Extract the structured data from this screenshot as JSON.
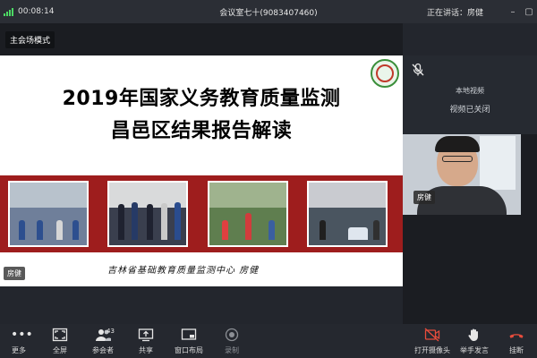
{
  "status": {
    "timer": "00:08:14",
    "meeting_title": "会议室七十(9083407460)",
    "speaker": "正在讲话：房健"
  },
  "mode": {
    "label": "主会场模式"
  },
  "slide": {
    "title_line1": "2019年国家义务教育质量监测",
    "title_line2": "昌邑区结果报告解读",
    "footer": "吉林省基础教育质量监测中心    房健",
    "presenter_tag": "房健"
  },
  "side_panel": {
    "local_video_line1": "本地视频",
    "local_video_line2": "视频已关闭",
    "camera_name": "房健"
  },
  "toolbar": {
    "more": "更多",
    "fullscreen": "全屏",
    "participants": "参会者",
    "participants_count": "43",
    "share": "共享",
    "layout": "窗口布局",
    "record": "录制",
    "camera": "打开摄像头",
    "raise_hand": "举手发言",
    "hangup": "挂断"
  },
  "colors": {
    "banner_red": "#9e1d1d",
    "hangup_red": "#e74c3c",
    "signal_green": "#4cd964"
  },
  "icons": {
    "more": "dots-icon",
    "fullscreen": "fullscreen-icon",
    "participants": "people-icon",
    "share": "share-icon",
    "layout": "layout-icon",
    "record": "record-icon",
    "camera": "camera-off-icon",
    "raise_hand": "hand-icon",
    "hangup": "phone-hangup-icon",
    "mic": "mic-muted-icon"
  }
}
